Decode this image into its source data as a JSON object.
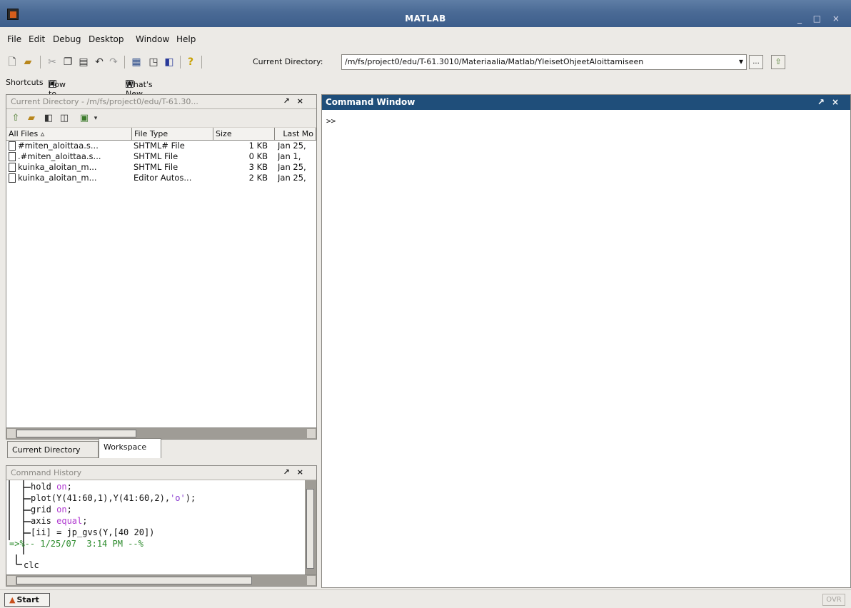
{
  "window": {
    "title": "MATLAB",
    "controls": "_ □ ×"
  },
  "menu": [
    "File",
    "Edit",
    "Debug",
    "Desktop",
    "Window",
    "Help"
  ],
  "toolbar": {
    "current_directory_label": "Current Directory:",
    "current_directory_value": "/m/fs/project0/edu/T-61.3010/Materiaalia/Matlab/YleisetOhjeetAloittamiseen",
    "browse_label": "..."
  },
  "shortcuts": {
    "label": "Shortcuts",
    "how_to_add": "How to Add",
    "whats_new": "What's New"
  },
  "current_directory_panel": {
    "title": "Current Directory - /m/fs/project0/edu/T-61.30...",
    "columns": [
      "All Files",
      "File Type",
      "Size",
      "Last Mo"
    ],
    "files": [
      {
        "name": "#miten_aloittaa.s...",
        "type": "SHTML# File",
        "size": "1 KB",
        "date": "Jan 25,"
      },
      {
        "name": ".#miten_aloittaa.s...",
        "type": "SHTML File",
        "size": "0 KB",
        "date": "Jan 1,"
      },
      {
        "name": "kuinka_aloitan_m...",
        "type": "SHTML File",
        "size": "3 KB",
        "date": "Jan 25,"
      },
      {
        "name": "kuinka_aloitan_m...",
        "type": "Editor Autos...",
        "size": "2 KB",
        "date": "Jan 25,"
      }
    ]
  },
  "tabs": [
    "Current Directory",
    "Workspace"
  ],
  "command_history": {
    "title": "Command History",
    "lines": [
      "hold on;",
      "plot(Y(41:60,1),Y(41:60,2),'o');",
      "grid on;",
      "axis equal;",
      "[ii] = jp_gvs(Y,[40 20])",
      "%-- 1/25/07  3:14 PM --%",
      "clc"
    ]
  },
  "command_window": {
    "title": "Command Window",
    "prompt": ">>"
  },
  "statusbar": {
    "start": "Start",
    "ovr": "OVR"
  }
}
